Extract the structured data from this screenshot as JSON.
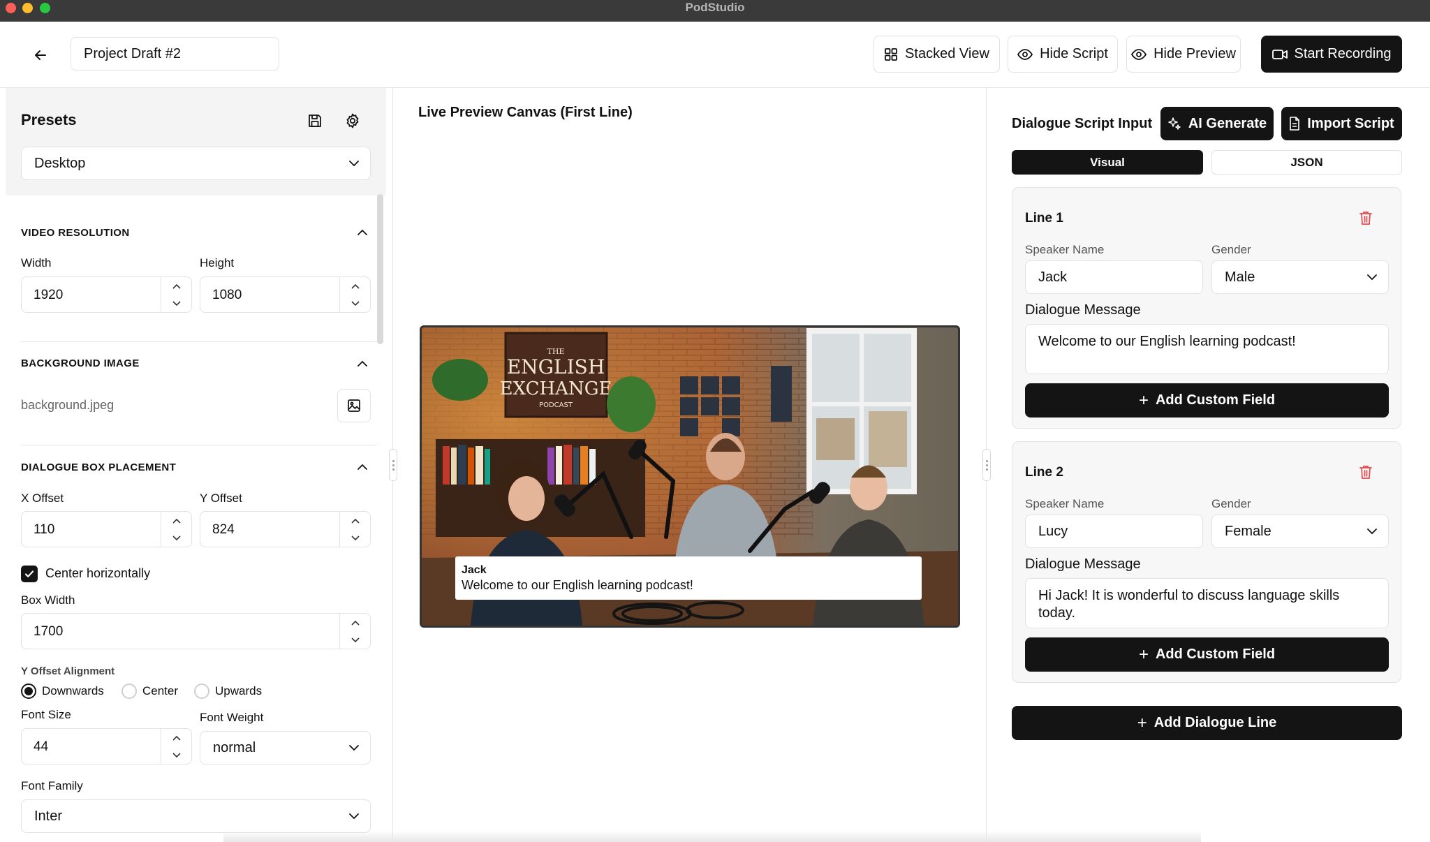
{
  "app": {
    "title": "PodStudio"
  },
  "header": {
    "project_name": "Project Draft #2",
    "stacked_view_label": "Stacked View",
    "hide_script_label": "Hide Script",
    "hide_preview_label": "Hide Preview",
    "start_recording_label": "Start Recording"
  },
  "presets": {
    "title": "Presets",
    "selected": "Desktop"
  },
  "video_resolution": {
    "title": "VIDEO RESOLUTION",
    "width_label": "Width",
    "width_value": "1920",
    "height_label": "Height",
    "height_value": "1080"
  },
  "background_image": {
    "title": "BACKGROUND IMAGE",
    "file_name": "background.jpeg"
  },
  "dialogue_box_placement": {
    "title": "DIALOGUE BOX PLACEMENT",
    "x_offset_label": "X Offset",
    "x_offset_value": "110",
    "y_offset_label": "Y Offset",
    "y_offset_value": "824",
    "center_horizontally_label": "Center horizontally",
    "center_horizontally_checked": true,
    "box_width_label": "Box Width",
    "box_width_value": "1700",
    "y_offset_alignment_label": "Y Offset Alignment",
    "alignment_options": [
      "Downwards",
      "Center",
      "Upwards"
    ],
    "alignment_selected": "Downwards",
    "font_size_label": "Font Size",
    "font_size_value": "44",
    "font_weight_label": "Font Weight",
    "font_weight_value": "normal",
    "font_family_label": "Font Family",
    "font_family_value": "Inter"
  },
  "preview": {
    "title": "Live Preview Canvas (First Line)",
    "sign_line1": "THE",
    "sign_line2": "ENGLISH",
    "sign_line3": "EXCHANGE",
    "sign_line4": "PODCAST",
    "dialogue_speaker": "Jack",
    "dialogue_message": "Welcome to our English learning podcast!"
  },
  "script": {
    "title": "Dialogue Script Input",
    "ai_generate_label": "AI Generate",
    "import_script_label": "Import Script",
    "tabs": [
      "Visual",
      "JSON"
    ],
    "active_tab": "Visual",
    "speaker_name_label": "Speaker Name",
    "gender_label": "Gender",
    "dialogue_message_label": "Dialogue Message",
    "add_custom_field_label": "Add Custom Field",
    "lines": [
      {
        "title": "Line 1",
        "speaker": "Jack",
        "gender": "Male",
        "message": "Welcome to our English learning podcast!"
      },
      {
        "title": "Line 2",
        "speaker": "Lucy",
        "gender": "Female",
        "message": "Hi Jack! It is wonderful to discuss language skills today."
      }
    ],
    "add_dialogue_line_label": "Add Dialogue Line"
  },
  "colors": {
    "accent_dark": "#141414",
    "danger": "#e5484d",
    "panel_bg": "#f4f4f4",
    "border": "#e2e2e2"
  }
}
